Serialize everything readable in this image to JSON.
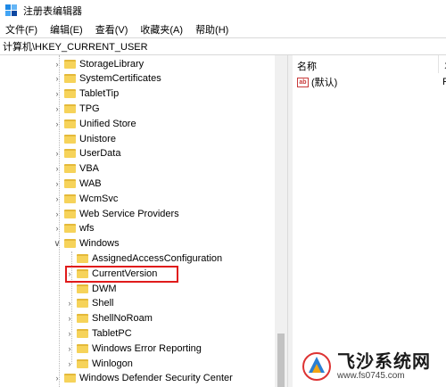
{
  "window": {
    "title": "注册表编辑器"
  },
  "menu": [
    "文件(F)",
    "编辑(E)",
    "查看(V)",
    "收藏夹(A)",
    "帮助(H)"
  ],
  "address": "计算机\\HKEY_CURRENT_USER",
  "tree": {
    "items": [
      {
        "label": "StorageLibrary",
        "level": 1,
        "expandable": true
      },
      {
        "label": "SystemCertificates",
        "level": 1,
        "expandable": true
      },
      {
        "label": "TabletTip",
        "level": 1,
        "expandable": true
      },
      {
        "label": "TPG",
        "level": 1,
        "expandable": true
      },
      {
        "label": "Unified Store",
        "level": 1,
        "expandable": true
      },
      {
        "label": "Unistore",
        "level": 1,
        "expandable": false
      },
      {
        "label": "UserData",
        "level": 1,
        "expandable": true
      },
      {
        "label": "VBA",
        "level": 1,
        "expandable": true
      },
      {
        "label": "WAB",
        "level": 1,
        "expandable": true
      },
      {
        "label": "WcmSvc",
        "level": 1,
        "expandable": true
      },
      {
        "label": "Web Service Providers",
        "level": 1,
        "expandable": true
      },
      {
        "label": "wfs",
        "level": 1,
        "expandable": true
      },
      {
        "label": "Windows",
        "level": 1,
        "expandable": true,
        "expanded": true
      },
      {
        "label": "AssignedAccessConfiguration",
        "level": 2,
        "expandable": false
      },
      {
        "label": "CurrentVersion",
        "level": 2,
        "expandable": true,
        "highlighted": true
      },
      {
        "label": "DWM",
        "level": 2,
        "expandable": false
      },
      {
        "label": "Shell",
        "level": 2,
        "expandable": true
      },
      {
        "label": "ShellNoRoam",
        "level": 2,
        "expandable": true
      },
      {
        "label": "TabletPC",
        "level": 2,
        "expandable": true
      },
      {
        "label": "Windows Error Reporting",
        "level": 2,
        "expandable": true
      },
      {
        "label": "Winlogon",
        "level": 2,
        "expandable": true
      },
      {
        "label": "Windows Defender Security Center",
        "level": 1,
        "expandable": true
      }
    ]
  },
  "values_pane": {
    "column_name": "名称",
    "column_type_cut": "丬",
    "default_value_name": "(默认)",
    "default_value_cut": "F"
  },
  "watermark": {
    "title": "飞沙系统网",
    "url": "www.fs0745.com"
  },
  "colors": {
    "folder": "#f6d35a",
    "highlight": "#e01b1b"
  }
}
